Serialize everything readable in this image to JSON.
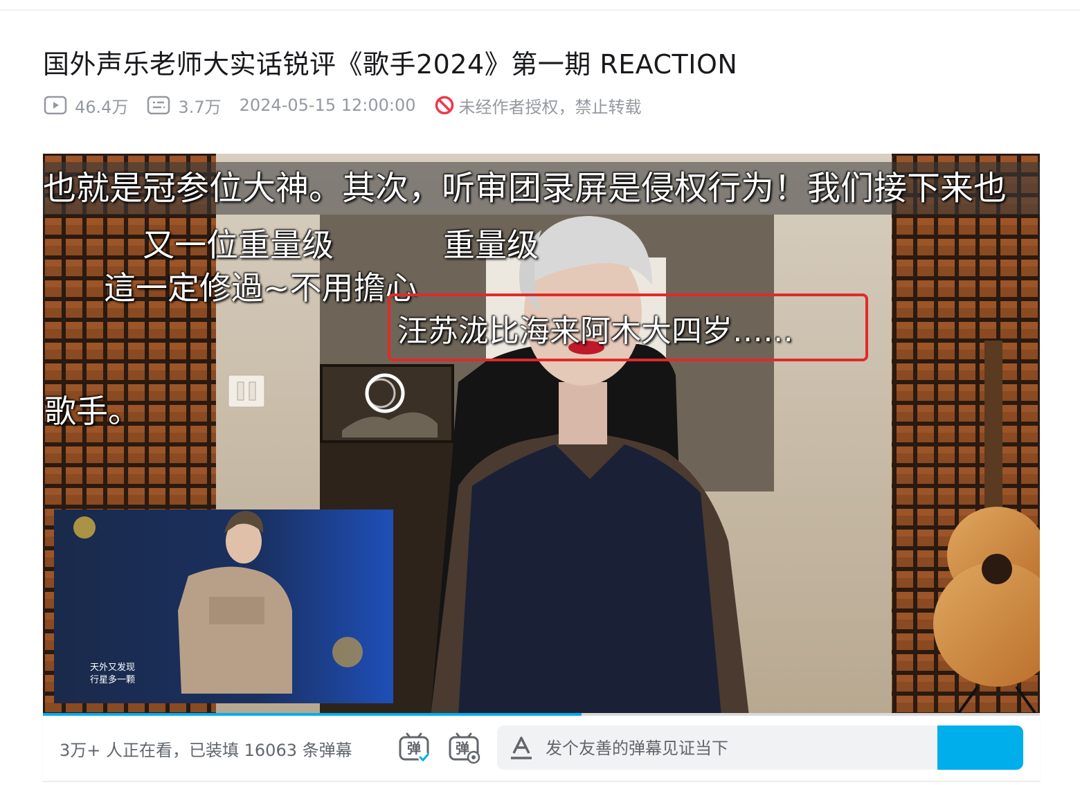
{
  "video": {
    "title": "国外声乐老师大实话锐评《歌手2024》第一期 REACTION",
    "views": "46.4万",
    "danmaku_count": "3.7万",
    "publish_time": "2024-05-15 12:00:00",
    "copyright_notice": "未经作者授权，禁止转载"
  },
  "player": {
    "subtitles": {
      "top": "也就是冠参位大神。其次，听审团录屏是侵权行为！我们接下来也",
      "left_1": "又一位重量级",
      "right_1": "重量级",
      "left_2": "這一定修過~不用擔心",
      "boxed": "汪苏泷比海来阿木大四岁……",
      "bottom_left": "歌手。"
    },
    "inset_caption_line1": "天外又发现",
    "inset_caption_line2": "行星多一颗",
    "progress_percent": 54
  },
  "danmaku_bar": {
    "viewers_text": "3万+ 人正在看，已装填 16063 条弹幕",
    "input_placeholder": "发个友善的弹幕见证当下",
    "toggle_label": "弹",
    "settings_label": "弹",
    "accent_color": "#00aeec"
  }
}
